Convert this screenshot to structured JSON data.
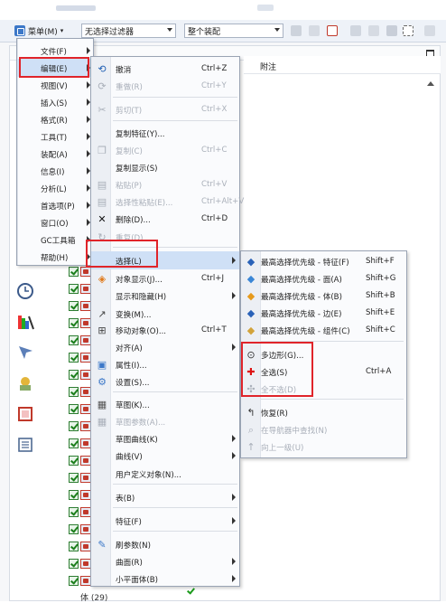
{
  "toolbar": {
    "menu_label": "菜单(M)",
    "filter_value": "无选择过滤器",
    "scope_value": "整个装配"
  },
  "panel": {
    "col_header": "附注",
    "bottom_row_label": "体 (29)"
  },
  "main_menu": [
    {
      "label": "文件(F)",
      "submenu": true
    },
    {
      "label": "编辑(E)",
      "submenu": true,
      "highlighted": true
    },
    {
      "label": "视图(V)",
      "submenu": true
    },
    {
      "label": "插入(S)",
      "submenu": true
    },
    {
      "label": "格式(R)",
      "submenu": true
    },
    {
      "label": "工具(T)",
      "submenu": true
    },
    {
      "label": "装配(A)",
      "submenu": true
    },
    {
      "label": "信息(I)",
      "submenu": true
    },
    {
      "label": "分析(L)",
      "submenu": true
    },
    {
      "label": "首选项(P)",
      "submenu": true
    },
    {
      "label": "窗口(O)",
      "submenu": true
    },
    {
      "label": "GC工具箱",
      "submenu": true
    },
    {
      "label": "帮助(H)",
      "submenu": true
    }
  ],
  "edit_menu": [
    {
      "label": "撤消",
      "shortcut": "Ctrl+Z",
      "icon": "undo-icon",
      "enabled": true
    },
    {
      "label": "重做(R)",
      "shortcut": "Ctrl+Y",
      "icon": "redo-icon",
      "enabled": false
    },
    {
      "label": "剪切(T)",
      "shortcut": "Ctrl+X",
      "icon": "cut-icon",
      "enabled": false
    },
    {
      "label": "复制特征(Y)...",
      "shortcut": "",
      "icon": "",
      "enabled": true
    },
    {
      "label": "复制(C)",
      "shortcut": "Ctrl+C",
      "icon": "copy-icon",
      "enabled": false
    },
    {
      "label": "复制显示(S)",
      "shortcut": "",
      "icon": "",
      "enabled": true
    },
    {
      "label": "粘贴(P)",
      "shortcut": "Ctrl+V",
      "icon": "paste-icon",
      "enabled": false
    },
    {
      "label": "选择性粘贴(E)...",
      "shortcut": "Ctrl+Alt+V",
      "icon": "paste-special-icon",
      "enabled": false
    },
    {
      "label": "删除(D)...",
      "shortcut": "Ctrl+D",
      "icon": "delete-icon",
      "enabled": true
    },
    {
      "label": "重复(D)",
      "shortcut": "",
      "icon": "repeat-icon",
      "enabled": false
    },
    {
      "label": "选择(L)",
      "shortcut": "",
      "icon": "",
      "enabled": true,
      "submenu": true,
      "highlighted": true
    },
    {
      "label": "对象显示(J)...",
      "shortcut": "Ctrl+J",
      "icon": "object-display-icon",
      "enabled": true
    },
    {
      "label": "显示和隐藏(H)",
      "shortcut": "",
      "icon": "",
      "enabled": true,
      "submenu": true
    },
    {
      "label": "变换(M)...",
      "shortcut": "",
      "icon": "transform-icon",
      "enabled": true
    },
    {
      "label": "移动对象(O)...",
      "shortcut": "Ctrl+T",
      "icon": "move-object-icon",
      "enabled": true
    },
    {
      "label": "对齐(A)",
      "shortcut": "",
      "icon": "",
      "enabled": true,
      "submenu": true
    },
    {
      "label": "属性(I)...",
      "shortcut": "",
      "icon": "properties-icon",
      "enabled": true
    },
    {
      "label": "设置(S)...",
      "shortcut": "",
      "icon": "settings-icon",
      "enabled": true
    },
    {
      "label": "草图(K)...",
      "shortcut": "",
      "icon": "sketch-icon",
      "enabled": true
    },
    {
      "label": "草图参数(A)...",
      "shortcut": "",
      "icon": "sketch-params-icon",
      "enabled": false
    },
    {
      "label": "草图曲线(K)",
      "shortcut": "",
      "icon": "",
      "enabled": true,
      "submenu": true
    },
    {
      "label": "曲线(V)",
      "shortcut": "",
      "icon": "",
      "enabled": true,
      "submenu": true
    },
    {
      "label": "用户定义对象(N)...",
      "shortcut": "",
      "icon": "",
      "enabled": true
    },
    {
      "label": "表(B)",
      "shortcut": "",
      "icon": "",
      "enabled": true,
      "submenu": true
    },
    {
      "label": "特征(F)",
      "shortcut": "",
      "icon": "",
      "enabled": true,
      "submenu": true
    },
    {
      "label": "刷参数(N)",
      "shortcut": "",
      "icon": "brush-params-icon",
      "enabled": true
    },
    {
      "label": "曲面(R)",
      "shortcut": "",
      "icon": "",
      "enabled": true,
      "submenu": true
    },
    {
      "label": "小平面体(B)",
      "shortcut": "",
      "icon": "",
      "enabled": true,
      "submenu": true
    }
  ],
  "select_menu": [
    {
      "label": "最高选择优先级 - 特征(F)",
      "shortcut": "Shift+F",
      "icon": "priority-feature-icon",
      "enabled": true
    },
    {
      "label": "最高选择优先级 - 面(A)",
      "shortcut": "Shift+G",
      "icon": "priority-face-icon",
      "enabled": true
    },
    {
      "label": "最高选择优先级 - 体(B)",
      "shortcut": "Shift+B",
      "icon": "priority-body-icon",
      "enabled": true
    },
    {
      "label": "最高选择优先级 - 边(E)",
      "shortcut": "Shift+E",
      "icon": "priority-edge-icon",
      "enabled": true
    },
    {
      "label": "最高选择优先级 - 组件(C)",
      "shortcut": "Shift+C",
      "icon": "priority-component-icon",
      "enabled": true
    },
    {
      "label": "多边形(G)...",
      "shortcut": "",
      "icon": "polygon-icon",
      "enabled": true
    },
    {
      "label": "全选(S)",
      "shortcut": "Ctrl+A",
      "icon": "select-all-icon",
      "enabled": true
    },
    {
      "label": "全不选(D)",
      "shortcut": "",
      "icon": "deselect-all-icon",
      "enabled": false
    },
    {
      "label": "恢复(R)",
      "shortcut": "",
      "icon": "restore-icon",
      "enabled": true
    },
    {
      "label": "在导航器中查找(N)",
      "shortcut": "",
      "icon": "find-navigator-icon",
      "enabled": false
    },
    {
      "label": "向上一级(U)",
      "shortcut": "",
      "icon": "up-level-icon",
      "enabled": false
    }
  ]
}
